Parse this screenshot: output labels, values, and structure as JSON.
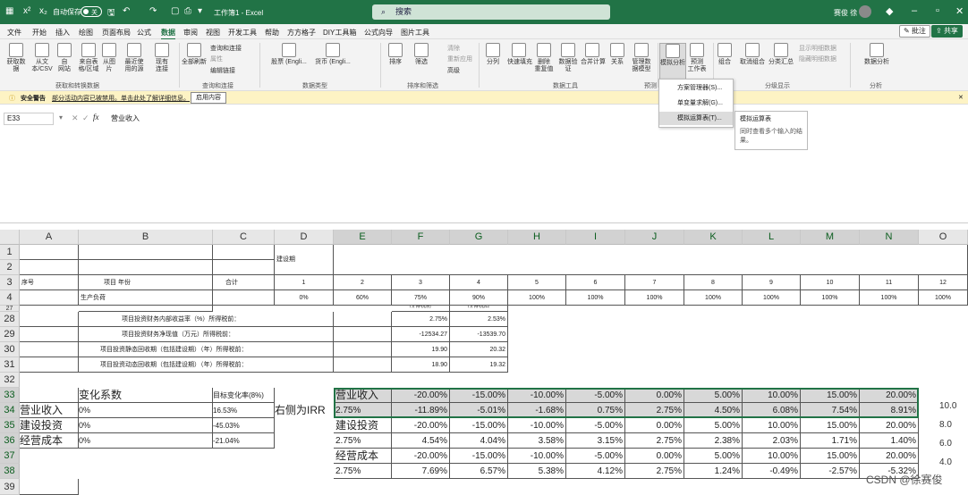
{
  "titlebar": {
    "autosave": "自动保存",
    "autosave_state": "关",
    "title": "工作簿1  -  Excel",
    "search_placeholder": "搜索",
    "user": "赛俊 徐"
  },
  "menu": [
    "文件",
    "开始",
    "插入",
    "绘图",
    "页面布局",
    "公式",
    "数据",
    "审阅",
    "视图",
    "开发工具",
    "帮助",
    "方方格子",
    "DIY工具箱",
    "公式向导",
    "图片工具"
  ],
  "menu_active": "数据",
  "top_buttons": {
    "comment": "批注",
    "share": "共享"
  },
  "ribbon": {
    "buttons": [
      "获取数\n据",
      "从文\n本/CSV",
      "自\n网站",
      "来自表\n格/区域",
      "从图\n片",
      "最近使\n用的源",
      "现有\n连接",
      "全部刷新",
      "股票 (Engli...",
      "货币 (Engli...",
      "排序",
      "筛选",
      "分列",
      "快速填充",
      "删除\n重复值",
      "数据验\n证",
      "合并计算",
      "关系",
      "管理数\n据模型",
      "模拟分析",
      "预测\n工作表",
      "组合",
      "取消组合",
      "分类汇总",
      "数据分析"
    ],
    "small": [
      "查询和连接",
      "属性",
      "编辑链接",
      "清除",
      "重新应用",
      "高级",
      "显示明细数据",
      "隐藏明细数据"
    ],
    "groups": [
      "获取和转换数据",
      "查询和连接",
      "数据类型",
      "排序和筛选",
      "数据工具",
      "预测",
      "分级显示",
      "分析"
    ]
  },
  "dropdown": [
    "方案管理器(S)...",
    "单变量求解(G)...",
    "模拟运算表(T)..."
  ],
  "tooltip": {
    "title": "模拟运算表",
    "body": "同时查看多个输入的结果。"
  },
  "security": {
    "label": "安全警告",
    "message": "部分活动内容已被禁用。单击此处了解详细信息。",
    "button": "启用内容"
  },
  "formula_bar": {
    "namebox": "E33",
    "fx": "fx",
    "content": "营业收入"
  },
  "columns": [
    "A",
    "B",
    "C",
    "D",
    "E",
    "F",
    "G",
    "H",
    "I",
    "J",
    "K",
    "L",
    "M",
    "N",
    "O"
  ],
  "rows": [
    "1",
    "2",
    "3",
    "4",
    "27",
    "28",
    "29",
    "30",
    "31",
    "32",
    "33",
    "34",
    "35",
    "36",
    "37",
    "38",
    "39"
  ],
  "cells": {
    "d1": "建设期",
    "a3": "序号",
    "b3": "项目  年份",
    "c3": "合计",
    "yr": [
      "1",
      "2",
      "3",
      "4",
      "5",
      "6",
      "7",
      "8",
      "9",
      "10",
      "11",
      "12"
    ],
    "b4": "生产负荷",
    "load": [
      "0%",
      "60%",
      "75%",
      "90%",
      "100%",
      "100%",
      "100%",
      "100%",
      "100%",
      "100%",
      "100%",
      "100%"
    ],
    "r27": [
      "所得税前",
      "所得税后"
    ],
    "b28": "项目投资财务内部收益率（%）所得税前：",
    "f28": "2.75%",
    "g28": "2.53%",
    "b29": "项目投资财务净现值（万元）所得税前：",
    "f29": "-12534.27",
    "g29": "-13539.70",
    "b30": "项目投资静态回收期（包括建设期）（年）所得税前：",
    "f30": "19.90",
    "g30": "20.32",
    "b31": "项目投资动态回收期（包括建设期）（年）所得税前：",
    "f31": "18.90",
    "g31": "19.32",
    "b33": "变化系数",
    "c33": "目标变化率(8%)",
    "a34": "营业收入",
    "b34": "0%",
    "c34": "16.53%",
    "a35": "建设投资",
    "b35": "0%",
    "c35": "-45.03%",
    "a36": "经营成本",
    "b36": "0%",
    "c36": "-21.04%",
    "d34": "右侧为IRR",
    "e33": "营业收入",
    "e34": "2.75%",
    "e35": "建设投资",
    "e36": "2.75%",
    "e37": "经营成本",
    "e38": "2.75%"
  },
  "table_rows": {
    "r33": [
      "-20.00%",
      "-15.00%",
      "-10.00%",
      "-5.00%",
      "0.00%",
      "5.00%",
      "10.00%",
      "15.00%",
      "20.00%"
    ],
    "r34": [
      "-11.89%",
      "-5.01%",
      "-1.68%",
      "0.75%",
      "2.75%",
      "4.50%",
      "6.08%",
      "7.54%",
      "8.91%"
    ],
    "r35": [
      "-20.00%",
      "-15.00%",
      "-10.00%",
      "-5.00%",
      "0.00%",
      "5.00%",
      "10.00%",
      "15.00%",
      "20.00%"
    ],
    "r36": [
      "4.54%",
      "4.04%",
      "3.58%",
      "3.15%",
      "2.75%",
      "2.38%",
      "2.03%",
      "1.71%",
      "1.40%"
    ],
    "r37": [
      "-20.00%",
      "-15.00%",
      "-10.00%",
      "-5.00%",
      "0.00%",
      "5.00%",
      "10.00%",
      "15.00%",
      "20.00%"
    ],
    "r38": [
      "7.69%",
      "6.57%",
      "5.38%",
      "4.12%",
      "2.75%",
      "1.24%",
      "-0.49%",
      "-2.57%",
      "-5.32%"
    ]
  },
  "side_axis": [
    "10.0",
    "8.0",
    "6.0",
    "4.0"
  ],
  "watermark": "CSDN @徐赛俊"
}
